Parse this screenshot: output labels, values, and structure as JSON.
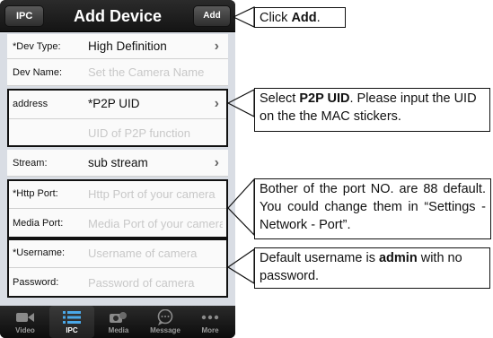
{
  "nav": {
    "back_label": "IPC",
    "title": "Add Device",
    "add_label": "Add"
  },
  "form": {
    "dev_type": {
      "label": "*Dev Type:",
      "value": "High Definition"
    },
    "dev_name": {
      "label": "Dev Name:",
      "placeholder": "Set the Camera Name"
    },
    "address": {
      "label": "address",
      "value": "*P2P UID",
      "uid_placeholder": "UID of P2P function"
    },
    "stream": {
      "label": "Stream:",
      "value": "sub stream"
    },
    "http_port": {
      "label": "*Http Port:",
      "placeholder": "Http Port of your camera"
    },
    "media_port": {
      "label": "Media Port:",
      "placeholder": "Media Port of your camera"
    },
    "username": {
      "label": "*Username:",
      "placeholder": "Username of camera"
    },
    "password": {
      "label": "Password:",
      "placeholder": "Password of camera"
    }
  },
  "tabs": [
    {
      "label": "Video",
      "icon": "video-camera-icon"
    },
    {
      "label": "IPC",
      "icon": "list-icon",
      "active": true
    },
    {
      "label": "Media",
      "icon": "media-icon"
    },
    {
      "label": "Message",
      "icon": "message-icon"
    },
    {
      "label": "More",
      "icon": "more-dots-icon"
    }
  ],
  "callouts": {
    "add": {
      "prefix": "Click ",
      "bold": "Add",
      "suffix": "."
    },
    "p2p": {
      "prefix": "Select ",
      "bold": "P2P UID",
      "suffix": ". Please input the UID on the  the MAC stickers."
    },
    "port": {
      "text": "Bother of the port NO. are 88 default. You could change them in “Settings - Network - Port”."
    },
    "user": {
      "prefix": "Default username is ",
      "bold": "admin",
      "suffix": " with no password."
    }
  }
}
